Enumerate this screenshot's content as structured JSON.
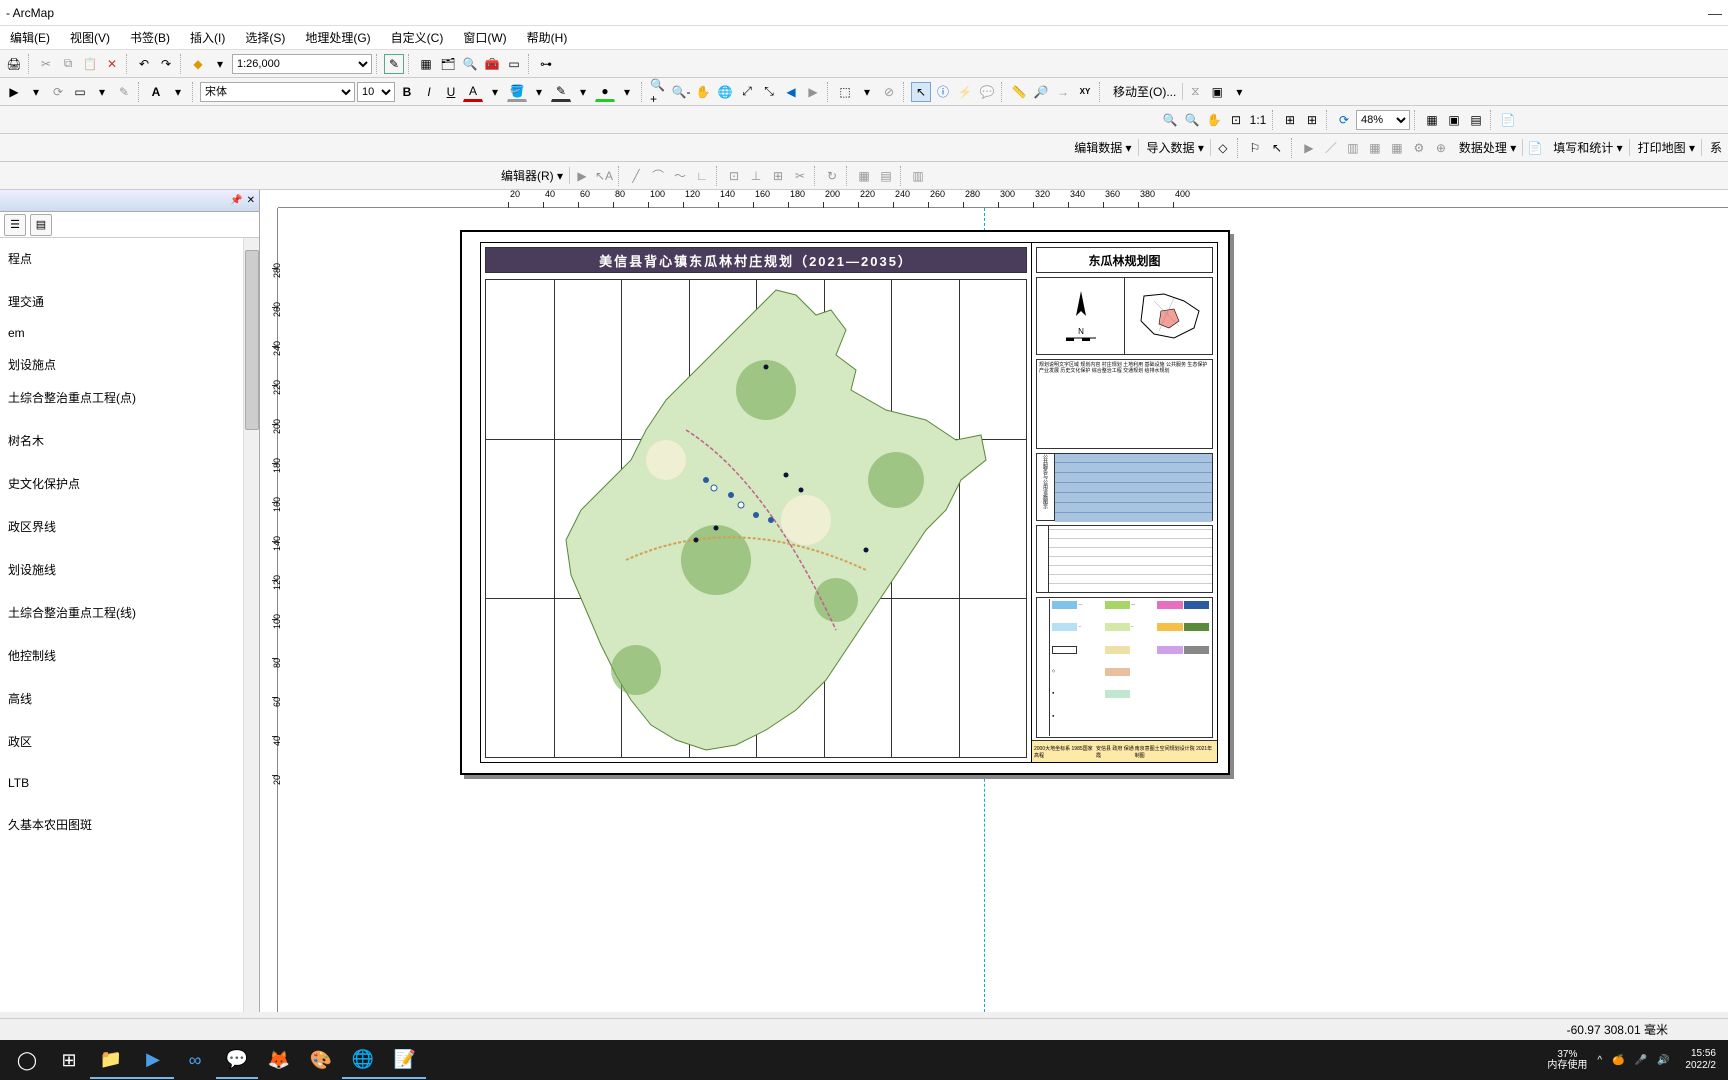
{
  "app": {
    "title": "- ArcMap"
  },
  "menu": {
    "items": [
      "编辑(E)",
      "视图(V)",
      "书签(B)",
      "插入(I)",
      "选择(S)",
      "地理处理(G)",
      "自定义(C)",
      "窗口(W)",
      "帮助(H)"
    ]
  },
  "toolbar1": {
    "scale": "1:26,000"
  },
  "toolbar2": {
    "font": "宋体",
    "size": "10",
    "moveTo": "移动至(O)..."
  },
  "toolbar3": {
    "zoom": "48%"
  },
  "toolbar4": {
    "editData": "编辑数据 ▾",
    "importData": "导入数据 ▾",
    "dataProc": "数据处理 ▾",
    "fillStat": "填写和统计 ▾",
    "printMap": "打印地图 ▾",
    "system": "系"
  },
  "toolbar5": {
    "editor": "编辑器(R) ▾"
  },
  "ruler_h": [
    20,
    40,
    60,
    80,
    100,
    120,
    140,
    160,
    180,
    200,
    220,
    240,
    260,
    280,
    300,
    320,
    340,
    360,
    380,
    400
  ],
  "ruler_v": [
    280,
    260,
    240,
    220,
    200,
    180,
    160,
    140,
    120,
    100,
    80,
    60,
    40,
    20
  ],
  "toc": {
    "items": [
      "程点",
      "理交通",
      "em",
      "划设施点",
      "土综合整治重点工程(点)",
      "树名木",
      "史文化保护点",
      "政区界线",
      "划设施线",
      "土综合整治重点工程(线)",
      "他控制线",
      "高线",
      "政区",
      "LTB",
      "久基本农田图斑"
    ]
  },
  "layout": {
    "map_title": "美信县背心镇东瓜林村庄规划（2021—2035）",
    "side_title": "东瓜林规划图",
    "footer_left": "2000大地坐标系 1985国家高程",
    "footer_mid": "安信县 政府 保通霞",
    "footer_right": "南京意图土空间规划设计院  2021年  制图"
  },
  "status": {
    "coords": "-60.97  308.01 毫米"
  },
  "taskbar": {
    "mem_pct": "37%",
    "mem_label": "内存使用",
    "time": "15:56",
    "date": "2022/2"
  }
}
